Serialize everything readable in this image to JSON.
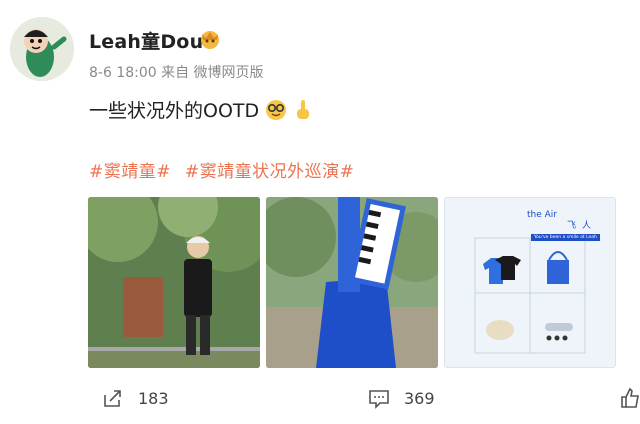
{
  "post": {
    "username": "Leah童Dou",
    "meta": "8-6 18:00  来自  微博网页版",
    "content_text": "一些状况外的OOTD",
    "content_emojis": [
      "nerd-face-emoji",
      "pointing-up-emoji"
    ],
    "tags": [
      "#窦靖童#",
      "#窦靖童状况外巡演#"
    ]
  },
  "poster": {
    "top_text_left": "the Air",
    "top_text_right": "飞人",
    "subtitle": "You've been a smile at Leah"
  },
  "actions": {
    "share_count": "183",
    "comment_count": "369"
  },
  "colors": {
    "tag": "#eb7350",
    "meta": "#8a8a8a",
    "accent_blue": "#1f4fc8"
  }
}
